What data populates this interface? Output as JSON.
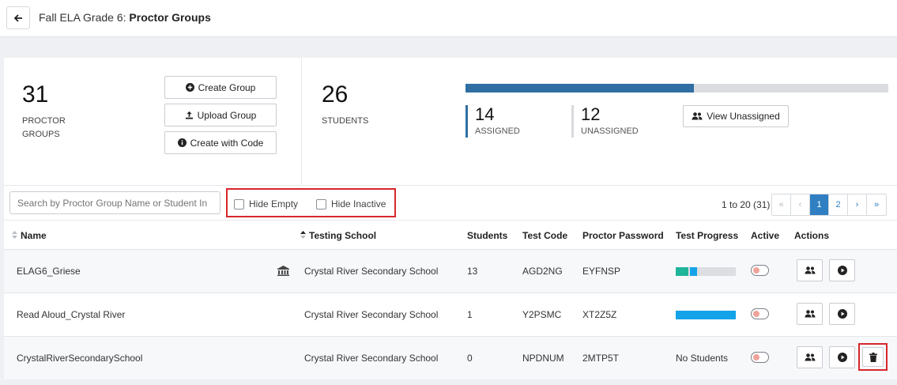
{
  "header": {
    "title_prefix": "Fall ELA Grade 6: ",
    "title_main": "Proctor Groups"
  },
  "summary": {
    "groups_count": "31",
    "groups_label_line1": "PROCTOR",
    "groups_label_line2": "GROUPS",
    "buttons": {
      "create": "Create Group",
      "upload": "Upload Group",
      "create_code": "Create with Code"
    },
    "students_count": "26",
    "students_label": "STUDENTS",
    "assigned_fraction": 0.54,
    "assigned_count": "14",
    "assigned_label": "ASSIGNED",
    "unassigned_count": "12",
    "unassigned_label": "UNASSIGNED",
    "view_unassigned": "View Unassigned"
  },
  "toolbar": {
    "search_placeholder": "Search by Proctor Group Name or Student In",
    "hide_empty": "Hide Empty",
    "hide_inactive": "Hide Inactive",
    "range": "1 to 20 (31)",
    "pager": {
      "first": "«",
      "prev": "‹",
      "page1": "1",
      "page2": "2",
      "next": "›",
      "last": "»"
    }
  },
  "table": {
    "headers": {
      "name": "Name",
      "school": "Testing School",
      "students": "Students",
      "code": "Test Code",
      "password": "Proctor Password",
      "progress": "Test Progress",
      "active": "Active",
      "actions": "Actions"
    },
    "rows": [
      {
        "name": "ELAG6_Griese",
        "school": "Crystal River Secondary School",
        "students": "13",
        "code": "AGD2NG",
        "password": "EYFNSP",
        "progress_text": ""
      },
      {
        "name": "Read Aloud_Crystal River",
        "school": "Crystal River Secondary School",
        "students": "1",
        "code": "Y2PSMC",
        "password": "XT2Z5Z",
        "progress_text": ""
      },
      {
        "name": "CrystalRiverSecondarySchool",
        "school": "Crystal River Secondary School",
        "students": "0",
        "code": "NPDNUM",
        "password": "2MTP5T",
        "progress_text": "No Students"
      }
    ]
  },
  "colors": {
    "accent": "#2f7fc2",
    "assigned_bar": "#2f6ea3",
    "highlight": "#d7262b",
    "progress_green": "#1fb59a",
    "progress_blue": "#14a3e8"
  }
}
